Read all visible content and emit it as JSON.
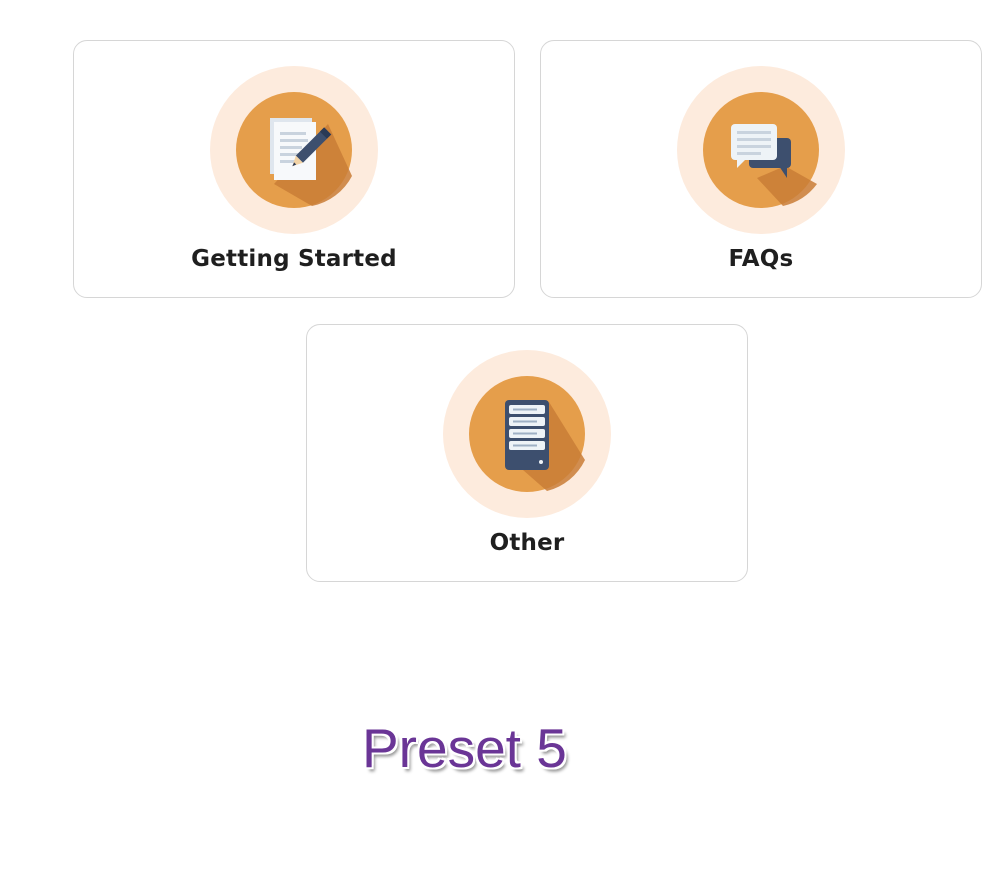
{
  "cards": [
    {
      "label": "Getting Started",
      "icon": "document-pencil-icon"
    },
    {
      "label": "FAQs",
      "icon": "chat-bubbles-icon"
    },
    {
      "label": "Other",
      "icon": "server-icon"
    }
  ],
  "footer": {
    "preset_label": "Preset 5"
  },
  "colors": {
    "icon_halo": "#FDEBDD",
    "icon_circle": "#E59E4B",
    "icon_shadow": "#C97D36",
    "preset_text": "#6A3596"
  }
}
